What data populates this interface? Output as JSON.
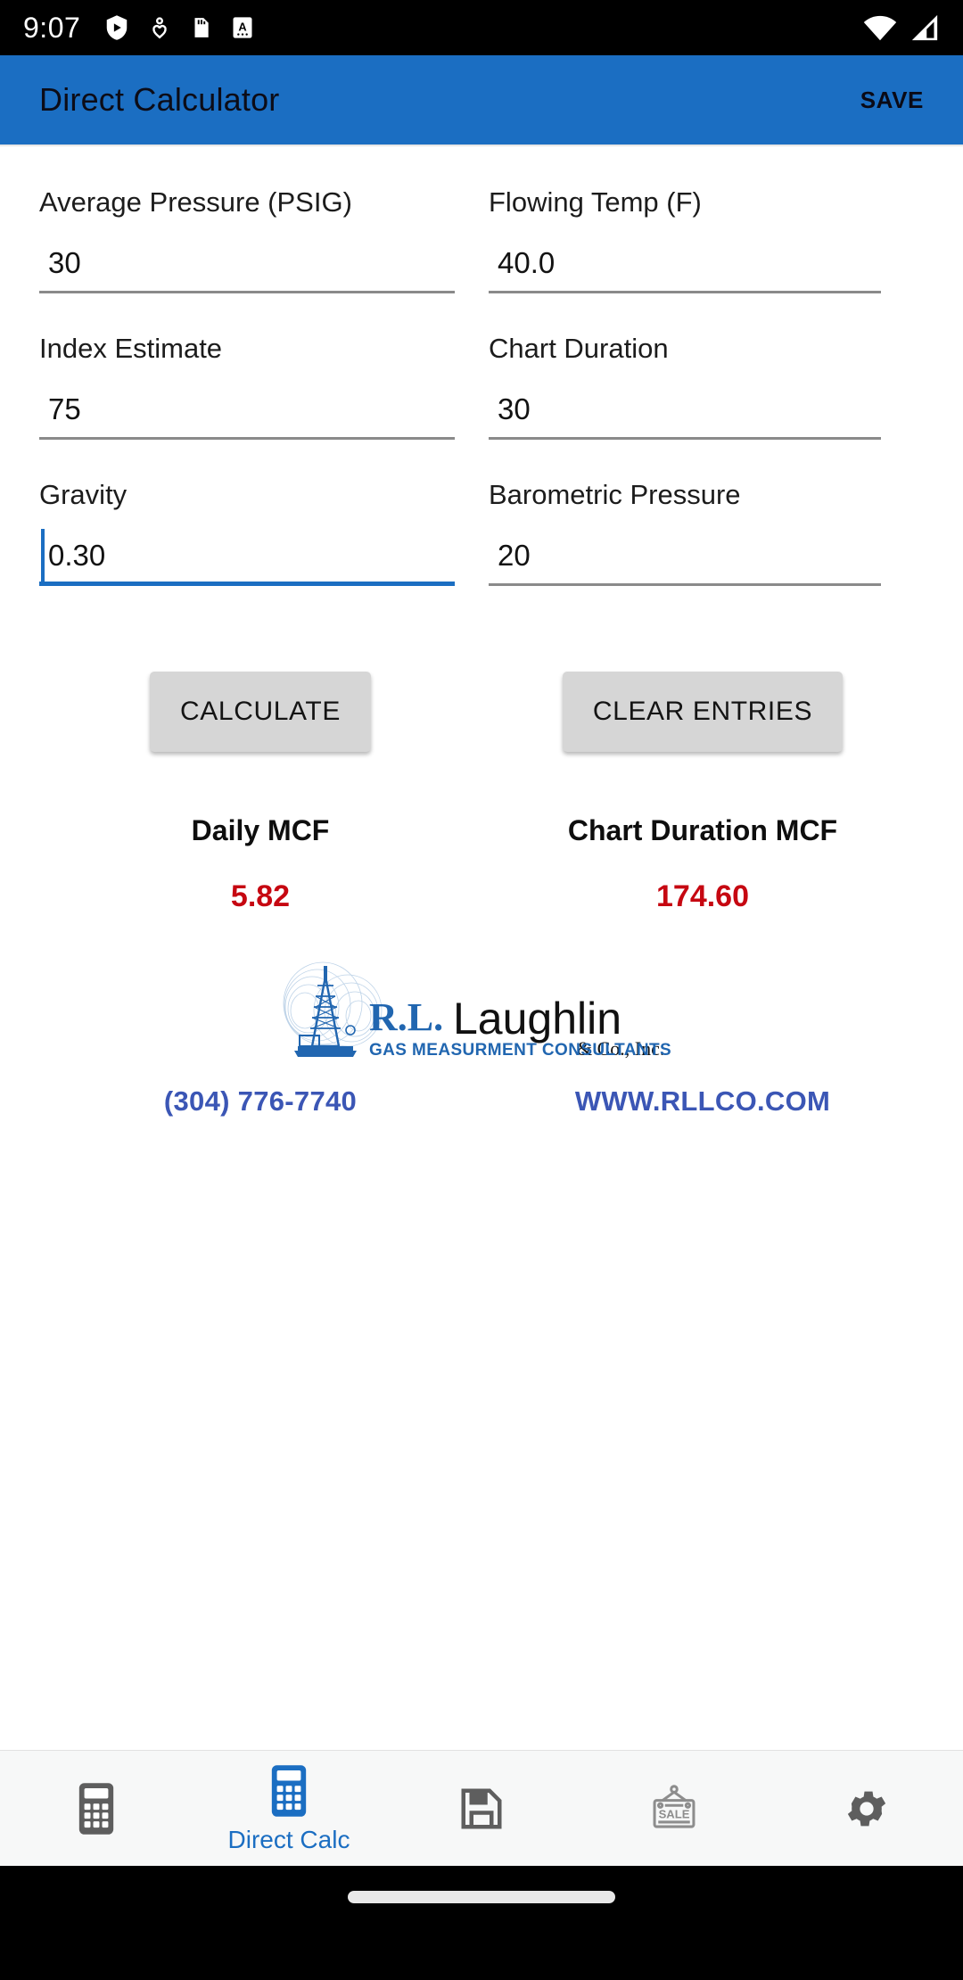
{
  "status_bar": {
    "time": "9:07",
    "left_icons": [
      "play-protect-icon",
      "health-icon",
      "sd-card-icon",
      "screenshot-a-icon"
    ],
    "right_icons": [
      "wifi-icon",
      "cellular-signal-icon"
    ]
  },
  "app_bar": {
    "title": "Direct Calculator",
    "save_label": "SAVE",
    "background_color": "#1b6ec2"
  },
  "form": {
    "fields": [
      {
        "label": "Average Pressure (PSIG)",
        "value": "30",
        "focused": false
      },
      {
        "label": "Flowing Temp (F)",
        "value": "40.0",
        "focused": false
      },
      {
        "label": "Index Estimate",
        "value": "75",
        "focused": false
      },
      {
        "label": "Chart Duration",
        "value": "30",
        "focused": false
      },
      {
        "label": "Gravity",
        "value": "0.30",
        "focused": true
      },
      {
        "label": "Barometric Pressure",
        "value": "20",
        "focused": false
      }
    ]
  },
  "actions": {
    "calculate_label": "CALCULATE",
    "clear_label": "CLEAR ENTRIES"
  },
  "results": [
    {
      "label": "Daily MCF",
      "value": "5.82"
    },
    {
      "label": "Chart Duration MCF",
      "value": "174.60"
    }
  ],
  "result_color": "#c60711",
  "logo": {
    "initials": "R.L.",
    "name": "Laughlin",
    "suffix": "& Co., Inc.",
    "tagline": "GAS MEASURMENT CONSULTANTS",
    "brand_color": "#2166b0"
  },
  "contact": {
    "phone": "(304) 776-7740",
    "website": "WWW.RLLCO.COM",
    "link_color": "#3b56b5"
  },
  "bottom_nav": {
    "items": [
      {
        "icon": "calculator-icon",
        "label": "",
        "active": false
      },
      {
        "icon": "calculator-icon",
        "label": "Direct Calc",
        "active": true
      },
      {
        "icon": "floppy-disk-save-icon",
        "label": "",
        "active": false
      },
      {
        "icon": "sale-sign-icon",
        "label": "",
        "active": false
      },
      {
        "icon": "gear-icon",
        "label": "",
        "active": false
      }
    ],
    "active_color": "#1b6ec2",
    "inactive_color": "#5e5e5e"
  }
}
